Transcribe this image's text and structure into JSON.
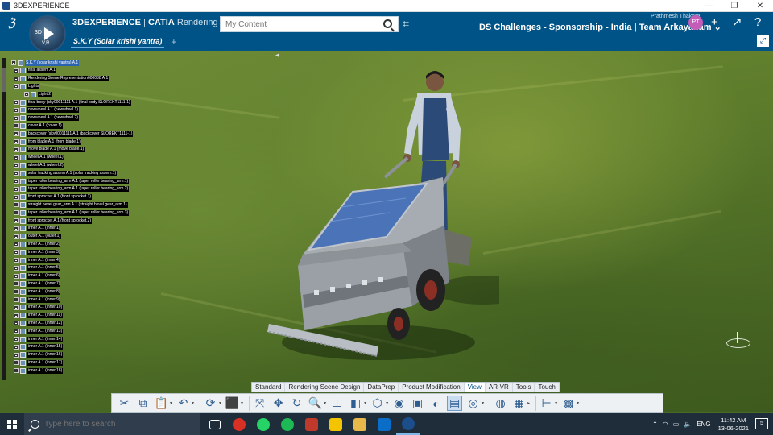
{
  "window": {
    "title": "3DEXPERIENCE",
    "buttons": [
      "—",
      "❐",
      "✕"
    ]
  },
  "header": {
    "brand_bold": "3DEXPERIENCE",
    "brand_sep": " | ",
    "brand_app": "CATIA",
    "brand_mode": " Rendering Scene...",
    "compass_3d": "3D",
    "compass_version": "V,R",
    "search_placeholder": "My Content",
    "user_name": "Prathmesh Thakare",
    "context": "DS Challenges - Sponsorship - India | Team Arkayanam ⌄",
    "avatar_initials": "PT",
    "tab_label": "S.K.Y (Solar krishi yantra)",
    "add_tab": "+"
  },
  "tree": {
    "nodes": [
      {
        "label": "S.K.Y (solar krishi yantra) A.1",
        "selected": true
      },
      {
        "label": "final assem A.1"
      },
      {
        "label": "Rendering Scene Representation000038 A.1"
      },
      {
        "label": "Lights"
      },
      {
        "label": "Light.2"
      },
      {
        "label": "final body (sky00011111 A.1 (final body SLOREKT1111-1)"
      },
      {
        "label": "newwheel A.1 (newwheel.1)"
      },
      {
        "label": "newwheel A.1 (newwheel.2)"
      },
      {
        "label": "cover A.1 (cover.1)"
      },
      {
        "label": "backcover (sky00011111 A.1 (backcover SLOREKT1111-1)"
      },
      {
        "label": "from blade A.1 (from blade.1)"
      },
      {
        "label": "move blade A.1 (move blade.1)"
      },
      {
        "label": "wheel A.1 (wheel.1)"
      },
      {
        "label": "wheel A.1 (wheel.2)"
      },
      {
        "label": "solar tracking assem A.1 (solar tracking assem.1)"
      },
      {
        "label": "taper roller bearing_arm A.1 (taper roller bearing_arm.1)"
      },
      {
        "label": "taper roller bearing_arm A.1 (taper roller bearing_arm.2)"
      },
      {
        "label": "front sprocket A.1 (front sprocket.1)"
      },
      {
        "label": "straight bevel gear_arm A.1 (straight bevel gear_arm.1)"
      },
      {
        "label": "taper roller bearing_arm A.1 (taper roller bearing_arm.3)"
      },
      {
        "label": "front sprocket A.1 (front sprocket.2)"
      },
      {
        "label": "inner A.1 (inner.1)"
      },
      {
        "label": "outer A.1 (outer.1)"
      },
      {
        "label": "inner A.1 (inner.2)"
      },
      {
        "label": "inner A.1 (inner.3)"
      },
      {
        "label": "inner A.1 (inner.4)"
      },
      {
        "label": "inner A.1 (inner.5)"
      },
      {
        "label": "inner A.1 (inner.6)"
      },
      {
        "label": "inner A.1 (inner.7)"
      },
      {
        "label": "inner A.1 (inner.8)"
      },
      {
        "label": "inner A.1 (inner.9)"
      },
      {
        "label": "inner A.1 (inner.10)"
      },
      {
        "label": "inner A.1 (inner.11)"
      },
      {
        "label": "inner A.1 (inner.12)"
      },
      {
        "label": "inner A.1 (inner.13)"
      },
      {
        "label": "inner A.1 (inner.14)"
      },
      {
        "label": "inner A.1 (inner.15)"
      },
      {
        "label": "inner A.1 (inner.16)"
      },
      {
        "label": "inner A.1 (inner.17)"
      },
      {
        "label": "inner A.1 (inner.18)"
      }
    ]
  },
  "actionbar": {
    "tabs": [
      "Standard",
      "Rendering Scene Design",
      "DataPrep",
      "Product Modification",
      "View",
      "AR-VR",
      "Tools",
      "Touch"
    ],
    "active_tab": "View"
  },
  "taskbar": {
    "search_placeholder": "Type here to search",
    "lang": "ENG",
    "time": "11:42 AM",
    "date": "13-06-2021",
    "notif_count": "5"
  },
  "colors": {
    "header_bg": "#005386",
    "tree_label_bg": "#000000",
    "selected_bg": "#2b63b0",
    "taskbar_bg": "#1f2c3a"
  }
}
